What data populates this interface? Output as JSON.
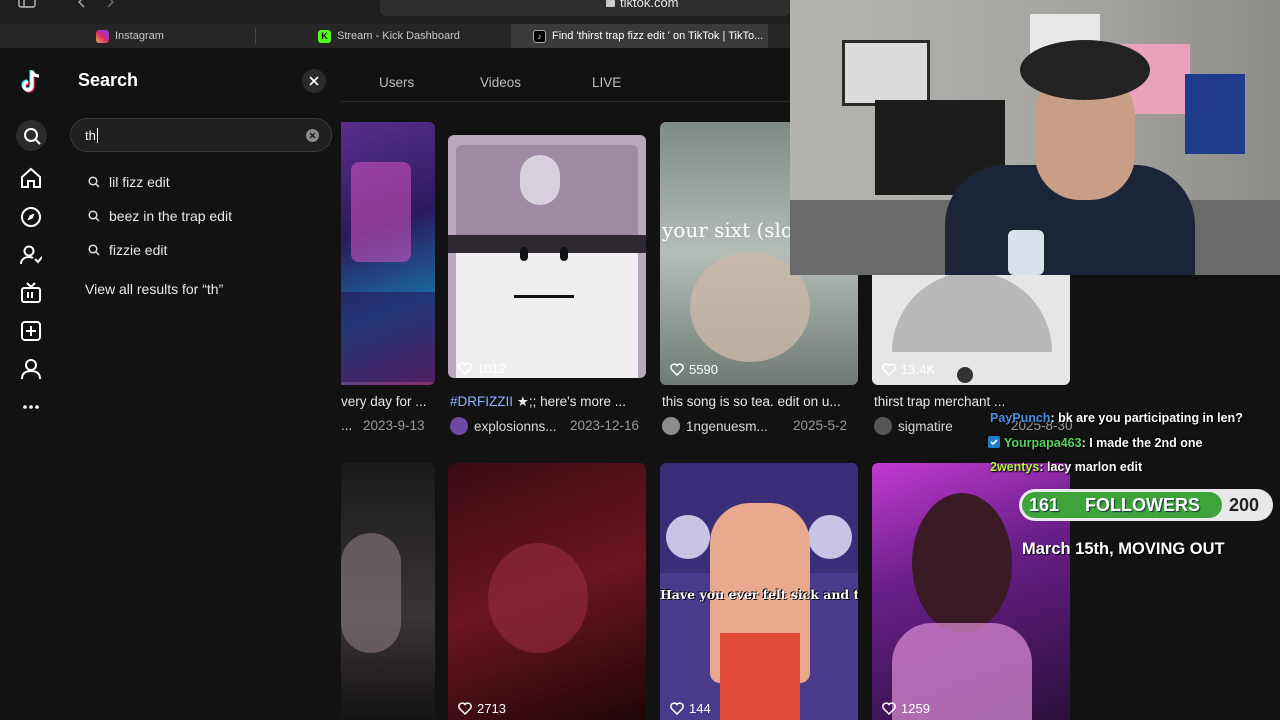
{
  "browser": {
    "url": "tiktok.com",
    "tabs": [
      {
        "label": "Instagram",
        "active": false
      },
      {
        "label": "Stream - Kick Dashboard",
        "active": false
      },
      {
        "label": "Find 'thirst trap fizz edit ' on TikTok | TikTo...",
        "active": true
      }
    ]
  },
  "sidebar": {
    "items": [
      "tiktok-logo",
      "search-icon",
      "home-icon",
      "explore-icon",
      "following-icon",
      "live-icon",
      "upload-icon",
      "profile-icon",
      "more-icon"
    ]
  },
  "search_panel": {
    "title": "Search",
    "input_value": "th",
    "suggestions": [
      "lil fizz edit",
      "beez in the trap edit",
      "fizzie edit"
    ],
    "view_all": "View all results for “th”"
  },
  "results_tabs": [
    "Users",
    "Videos",
    "LIVE"
  ],
  "videos_row1": [
    {
      "caption": "very day for ...",
      "author": "...",
      "date": "2023-9-13",
      "likes": ""
    },
    {
      "caption_tag": "#DRFIZZII",
      "caption": " ★;; here's more ...",
      "author": "explosionns...",
      "date": "2023-12-16",
      "likes": "1012"
    },
    {
      "caption": "this song is so tea. edit on u...",
      "author": "1ngenuesm...",
      "date": "2025-5-2",
      "likes": "5590",
      "overlay_text": "your sixt (slowed - Bilips"
    },
    {
      "caption": "thirst trap merchant ...",
      "author": "sigmatire",
      "date": "2025-8-30",
      "likes": "13.4K"
    }
  ],
  "videos_row2": [
    {
      "likes": ""
    },
    {
      "likes": "2713"
    },
    {
      "likes": "144",
      "overlay_text": "Have you ever felt sick and tired"
    },
    {
      "likes": "1259"
    }
  ],
  "stream_chat": [
    {
      "user": "PayPunch",
      "message": ": bk are you participating in len?",
      "color": "#4a90e2"
    },
    {
      "user": "Yourpapa463",
      "message": ": I made the 2nd one",
      "color": "#59d35c"
    },
    {
      "user": "2wentys",
      "message": ": lacy marlon edit",
      "color": "#b9f24a"
    }
  ],
  "followers_goal": {
    "current": "161",
    "label": "FOLLOWERS",
    "goal": "200",
    "progress": 0.805
  },
  "announcement": "March 15th, MOVING OUT"
}
